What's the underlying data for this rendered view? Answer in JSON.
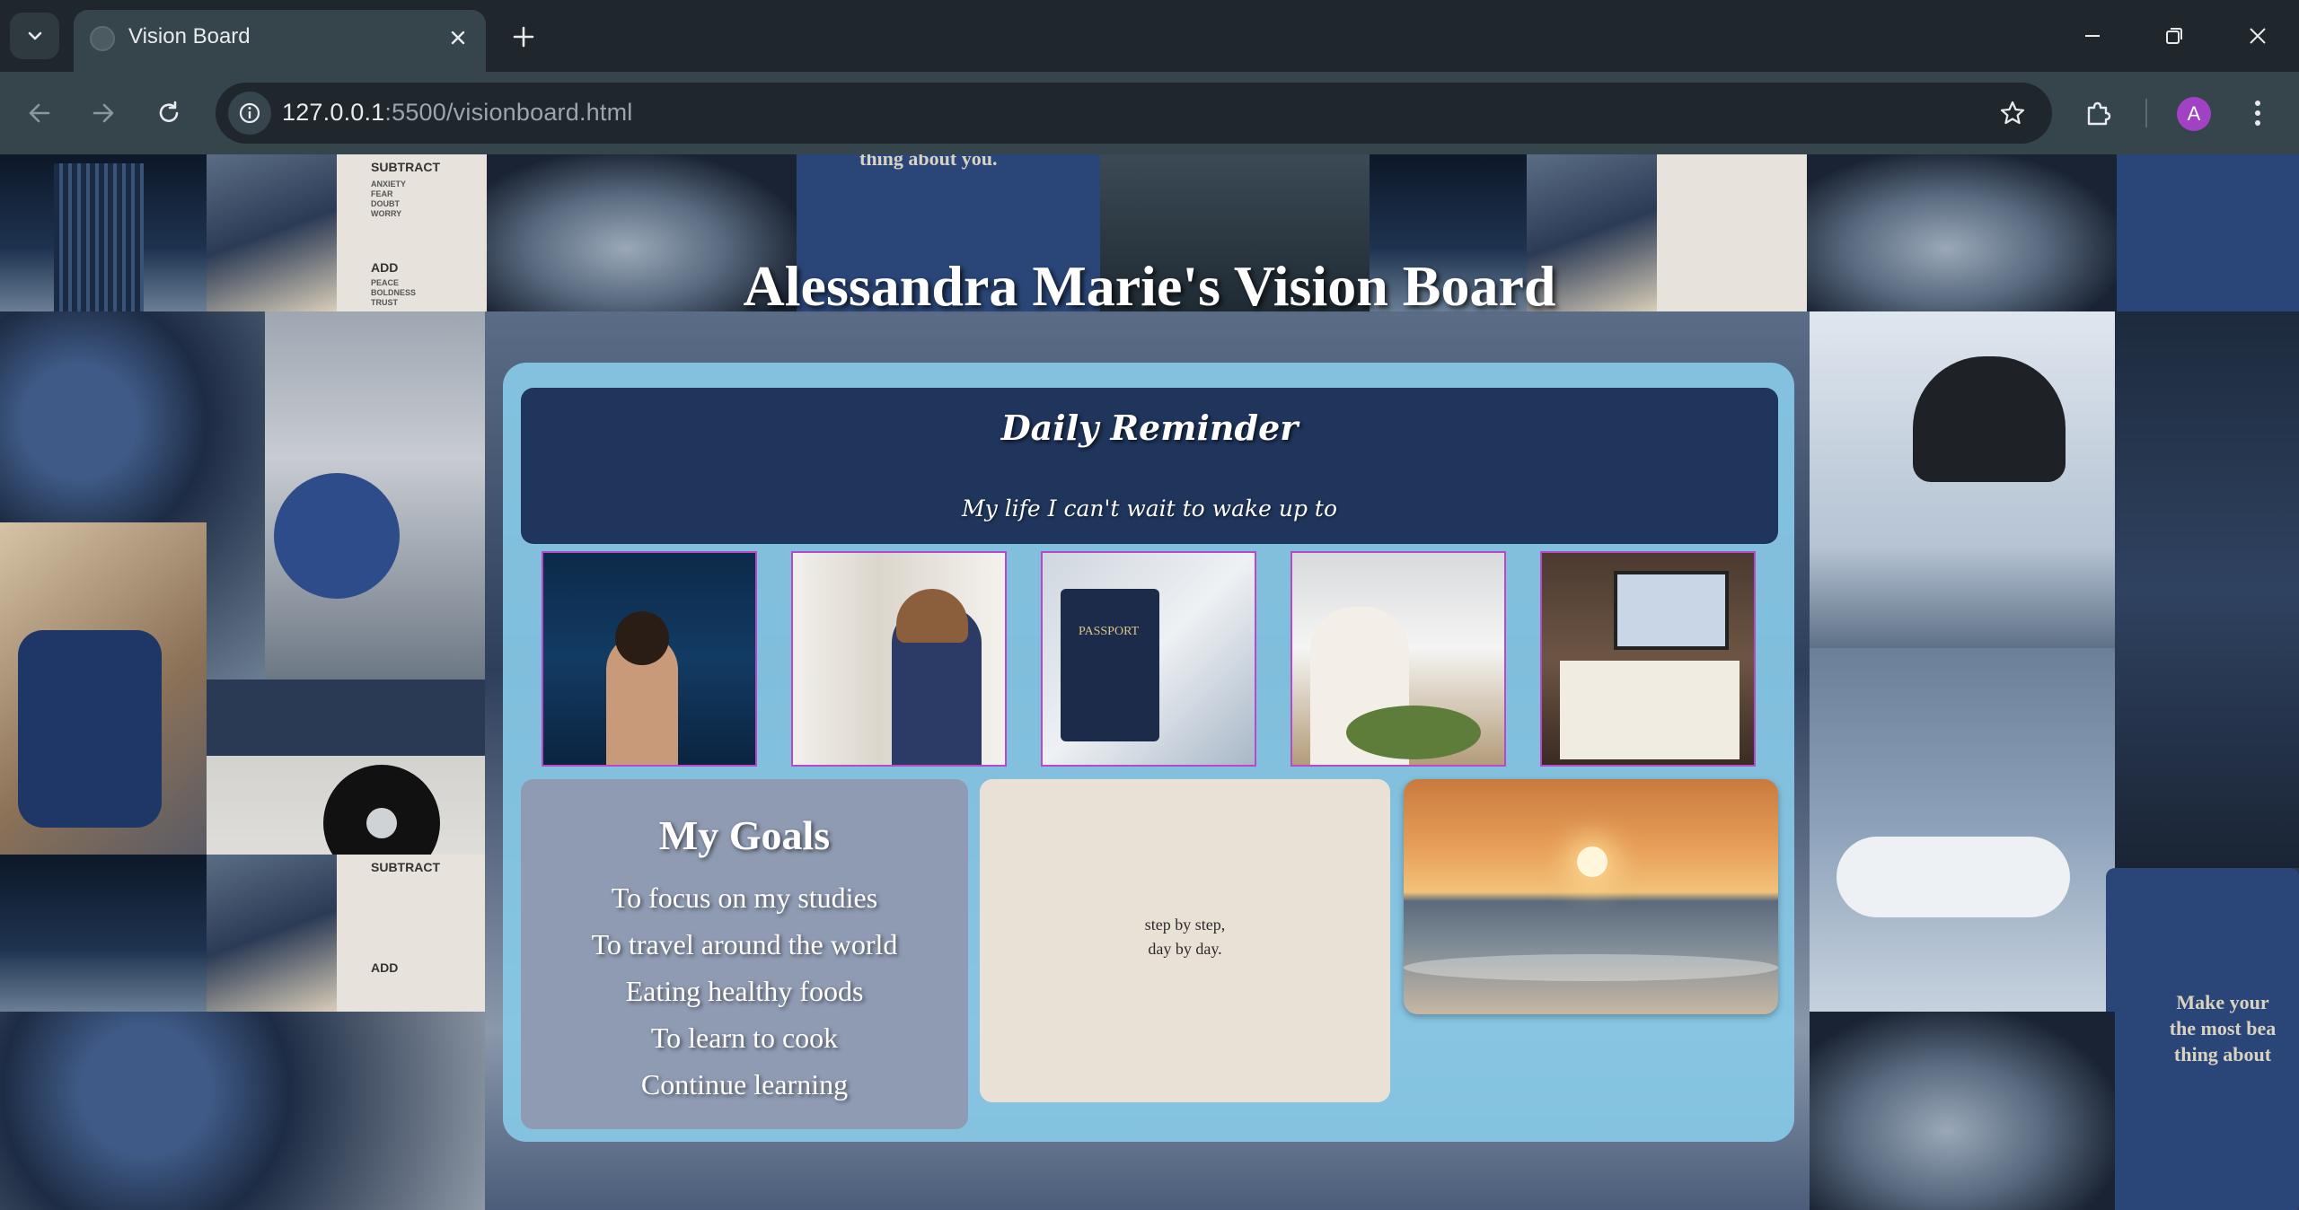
{
  "browser": {
    "tab_title": "Vision Board",
    "url_host": "127.0.0.1",
    "url_rest": ":5500/visionboard.html",
    "avatar_letter": "A"
  },
  "page": {
    "title": "Alessandra Marie's Vision Board",
    "reminder": {
      "title": "Daily Reminder",
      "subtitle": "My life I can't wait to wake up to"
    },
    "photos": [
      {
        "name": "reading-by-the-sea-photo"
      },
      {
        "name": "graduation-photo"
      },
      {
        "name": "passport-travel-photo"
      },
      {
        "name": "cooking-photo"
      },
      {
        "name": "studying-photo"
      }
    ],
    "goals": {
      "title": "My Goals",
      "items": [
        "To focus on my studies",
        "To travel around the world",
        "Eating healthy foods",
        "To learn to cook",
        "Continue learning"
      ]
    },
    "quote": {
      "line1": "step by step,",
      "line2": "day by day."
    },
    "background_text": {
      "subtract_heading": "SUBTRACT",
      "subtract_items": "ANXIETY\nFEAR\nDOUBT\nWORRY",
      "add_heading": "ADD",
      "add_items": "PEACE\nBOLDNESS\nTRUST",
      "quote_fragment": "thing about you.",
      "quote_card": "Make your\nthe most bea\nthing about"
    }
  },
  "colors": {
    "chrome_dark": "#1f272c",
    "chrome_toolbar": "#36444b",
    "board": "#87c8e6",
    "reminder": "#1f355c",
    "goals": "#8f9bb3",
    "quote": "#e9e1d6",
    "photo_border": "#b64ac9"
  }
}
